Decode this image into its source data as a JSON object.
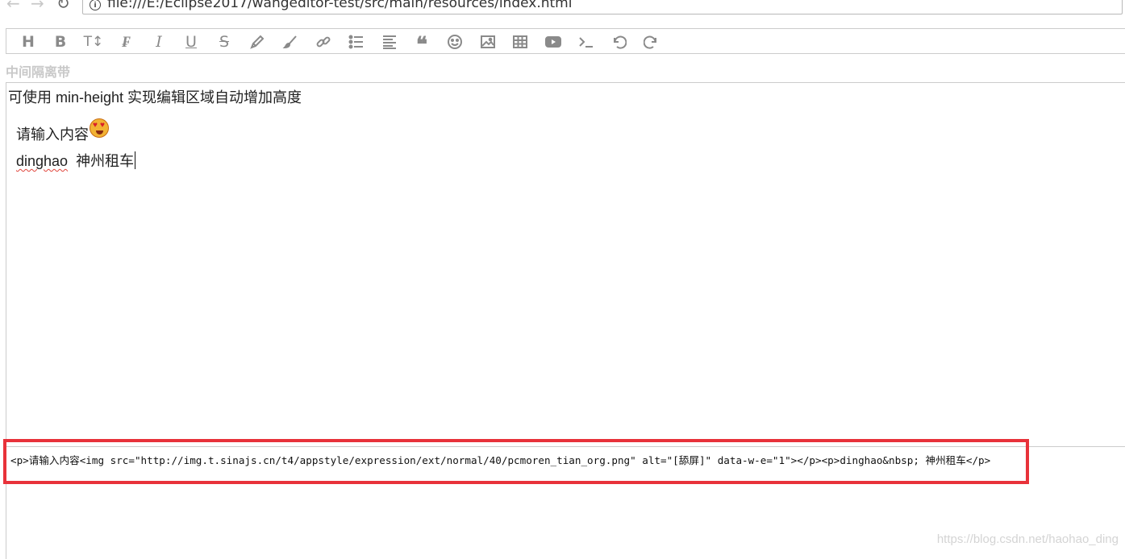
{
  "browser": {
    "url": "file:///E:/Eclipse2017/wangeditor-test/src/main/resources/index.html",
    "info_icon": "i"
  },
  "toolbar": {
    "items": [
      {
        "name": "heading-icon",
        "glyph": "H"
      },
      {
        "name": "bold-icon",
        "glyph": "B"
      },
      {
        "name": "font-size-icon",
        "glyph": "T↕"
      },
      {
        "name": "font-family-icon",
        "glyph": "F"
      },
      {
        "name": "italic-icon",
        "glyph": "I"
      },
      {
        "name": "underline-icon",
        "glyph": "U"
      },
      {
        "name": "strikethrough-icon",
        "glyph": "S"
      },
      {
        "name": "text-color-icon",
        "glyph": "pencil"
      },
      {
        "name": "background-color-icon",
        "glyph": "brush"
      },
      {
        "name": "link-icon",
        "glyph": "link"
      },
      {
        "name": "list-icon",
        "glyph": "list"
      },
      {
        "name": "justify-icon",
        "glyph": "align"
      },
      {
        "name": "quote-icon",
        "glyph": "quote"
      },
      {
        "name": "emoticon-icon",
        "glyph": "smile"
      },
      {
        "name": "image-icon",
        "glyph": "image"
      },
      {
        "name": "table-icon",
        "glyph": "table"
      },
      {
        "name": "video-icon",
        "glyph": "video"
      },
      {
        "name": "code-icon",
        "glyph": "code"
      },
      {
        "name": "undo-icon",
        "glyph": "undo"
      },
      {
        "name": "redo-icon",
        "glyph": "redo"
      }
    ]
  },
  "separator_label": "中间隔离带",
  "editor": {
    "line1": "可使用 min-height 实现编辑区域自动增加高度",
    "line2": "请输入内容",
    "emoji_icon": "heart-eyes-emoji",
    "line3_word": "dinghao",
    "line3_rest": "  神州租车"
  },
  "source_html": "<p>请输入内容<img src=\"http://img.t.sinajs.cn/t4/appstyle/expression/ext/normal/40/pcmoren_tian_org.png\" alt=\"[舔屏]\" data-w-e=\"1\"></p><p>dinghao&nbsp; 神州租车</p>",
  "colors": {
    "highlight_border": "#e8323a",
    "toolbar_icon": "#8a8a8a",
    "separator_text": "#c9c9c9",
    "spellcheck": "#e0443b"
  },
  "watermark": "https://blog.csdn.net/haohao_ding"
}
